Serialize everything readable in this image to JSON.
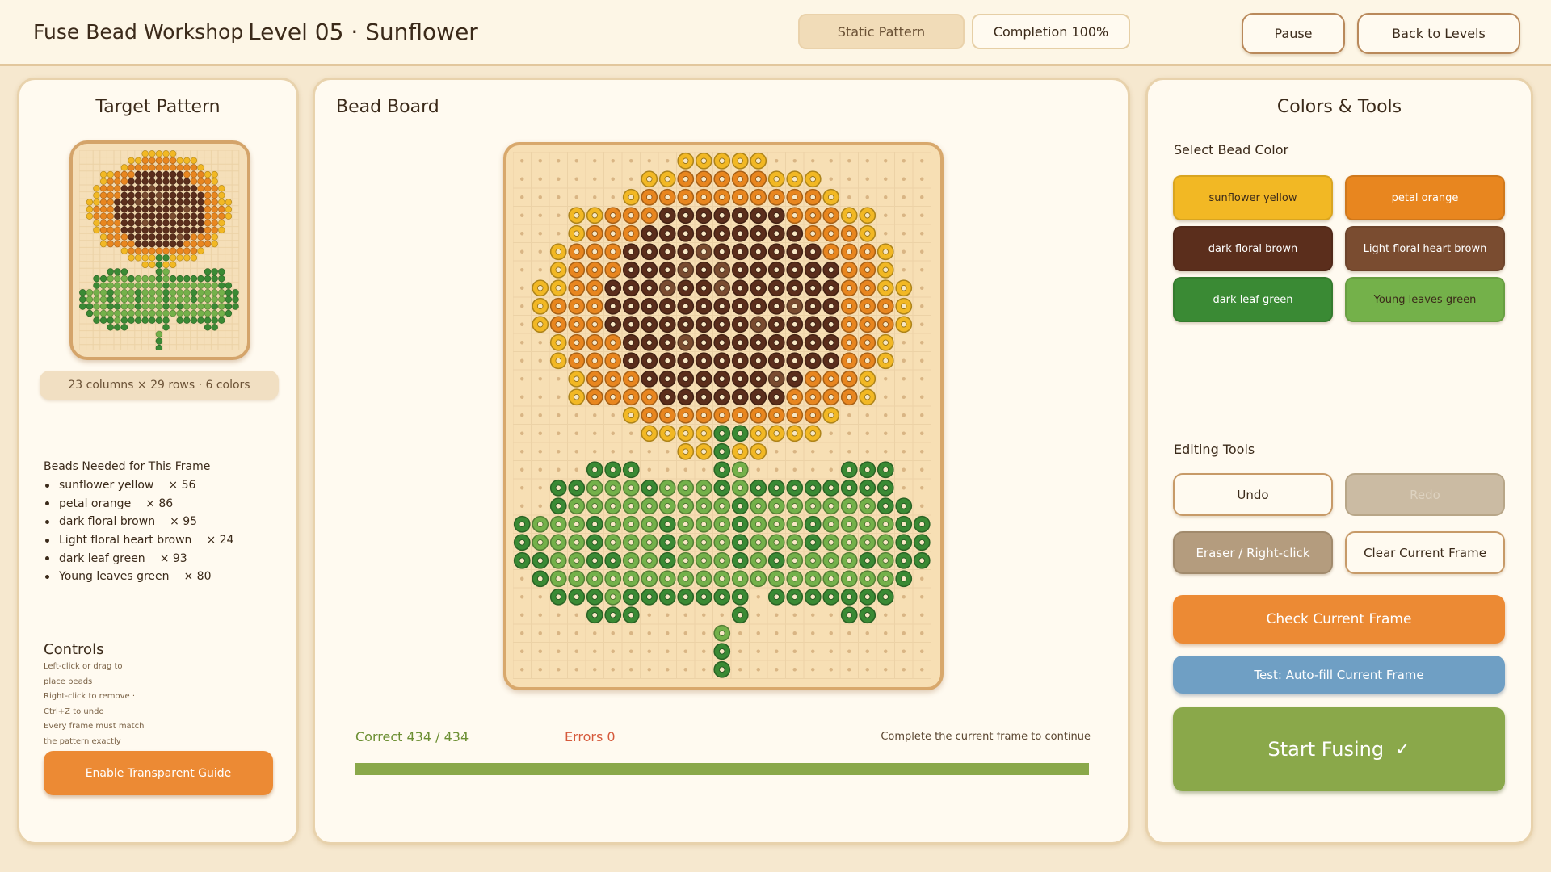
{
  "header": {
    "app_title": "Fuse Bead Workshop",
    "level_title": "Level 05 · Sunflower",
    "mode_label": "Static Pattern",
    "completion_label": "Completion 100%",
    "pause_label": "Pause",
    "back_label": "Back to Levels"
  },
  "target": {
    "title": "Target Pattern",
    "dims_label": "23 columns × 29 rows · 6 colors",
    "needed_title": "Beads Needed for This Frame",
    "needed": [
      {
        "name": "sunflower yellow",
        "count": "× 56"
      },
      {
        "name": "petal orange",
        "count": "× 86"
      },
      {
        "name": "dark floral brown",
        "count": "× 95"
      },
      {
        "name": "Light floral heart brown",
        "count": "× 24"
      },
      {
        "name": "dark leaf green",
        "count": "× 93"
      },
      {
        "name": "Young leaves green",
        "count": "× 80"
      }
    ],
    "controls_title": "Controls",
    "controls_hints": [
      "Left-click or drag to",
      "place beads",
      "Right-click to remove ·",
      "Ctrl+Z to undo",
      "Every frame must match",
      "the pattern exactly"
    ],
    "guide_button": "Enable Transparent Guide"
  },
  "board": {
    "title": "Bead Board",
    "correct_label": "Correct 434 / 434",
    "errors_label": "Errors 0",
    "status_message": "Complete the current frame to continue",
    "progress": 1.0
  },
  "tools": {
    "title": "Colors & Tools",
    "select_color_label": "Select Bead Color",
    "colors": [
      {
        "label": "sunflower yellow",
        "hex": "#f2b824",
        "text": "#3b2a1a"
      },
      {
        "label": "petal orange",
        "hex": "#e8861f",
        "text": "#ffffff"
      },
      {
        "label": "dark floral brown",
        "hex": "#5b2e1c",
        "text": "#ffffff"
      },
      {
        "label": "Light floral heart brown",
        "hex": "#7a4c30",
        "text": "#ffffff"
      },
      {
        "label": "dark leaf green",
        "hex": "#3a8a34",
        "text": "#ffffff"
      },
      {
        "label": "Young leaves green",
        "hex": "#74b14a",
        "text": "#3b2a1a"
      }
    ],
    "editing_label": "Editing Tools",
    "undo_label": "Undo",
    "redo_label": "Redo",
    "eraser_label": "Eraser / Right-click",
    "clear_label": "Clear Current Frame",
    "check_label": "Check Current Frame",
    "autofill_label": "Test: Auto-fill Current Frame",
    "fuse_label": "Start Fusing",
    "fuse_icon": "check-icon"
  },
  "pattern": {
    "columns": 23,
    "rows": 29,
    "palette": {
      "Y": "#f2b824",
      "O": "#e8861f",
      "D": "#5b2e1c",
      "L": "#7a4c30",
      "G": "#3a8a34",
      "g": "#74b14a"
    },
    "grid": [
      ".........YYYYY.........",
      ".......YYOOOOOYYY......",
      "......YOOOOOOOOOOY.....",
      "...YYOOODDDDDDDOOOYY...",
      "...YOOODDDDDDDDDOOOY...",
      "..YOOODDDDLDDDDDDOOOY..",
      "..YOOODDDLDLDDDDDDOOY..",
      ".YYOODDDLDDLDDDDDDOOYY.",
      ".YOOODDDDDDDDDDLDDOOOY.",
      ".YOOODDDDDDDDLDDDDOOOY.",
      "..YOOODDDLDDDDDDDDOOY..",
      "..YOOODDDDDDDDDDDDOOY..",
      "...YOOODDDDDDDLDOOOY...",
      "...YOOOODDDDDDDOOOOY...",
      "......YOOOOOOOOOOY.....",
      ".......YYYYGGYYYY......",
      ".........YYGYY.........",
      "....GGG....Gg.....GGG..",
      "..GGgggGgggGgGGGGGGGG..",
      "..GgggggggggGgggggggGG.",
      "GgggGgggGgggGgggGggggGG",
      "GgggGgggGgggGgggGggggGG",
      "GGggGGggGgggGgGggggGgGG",
      ".GgggggggggggggggggggG.",
      "..GGGgGGGGGGG.GGGGGGG..",
      "....GGG.....G.....GG...",
      "...........g...........",
      "...........G...........",
      "...........G..........."
    ]
  }
}
